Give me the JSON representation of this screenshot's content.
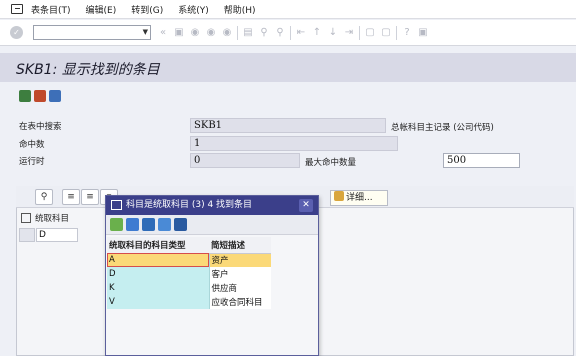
{
  "menu": [
    "表条目(T)",
    "编辑(E)",
    "转到(G)",
    "系统(Y)",
    "帮助(H)"
  ],
  "title": "SKB1: 显示找到的条目",
  "form": {
    "search_label": "在表中搜索",
    "search_value": "SKB1",
    "search_desc": "总帐科目主记录 (公司代码)",
    "hits_label": "命中数",
    "hits_value": "1",
    "runtime_label": "运行时",
    "runtime_value": "0",
    "max_hits_label": "最大命中数量",
    "max_hits_value": "500"
  },
  "result": {
    "detail_label": "详细...",
    "column_header": "统取科目",
    "row_value": "D"
  },
  "popup": {
    "title": "科目是统取科目 (3)   4 找到条目",
    "columns": [
      "统取科目的科目类型",
      "简短描述"
    ],
    "rows": [
      {
        "type": "A",
        "desc": "资产"
      },
      {
        "type": "D",
        "desc": "客户"
      },
      {
        "type": "K",
        "desc": "供应商"
      },
      {
        "type": "V",
        "desc": "应收合同科目"
      }
    ],
    "selected_index": 0
  }
}
